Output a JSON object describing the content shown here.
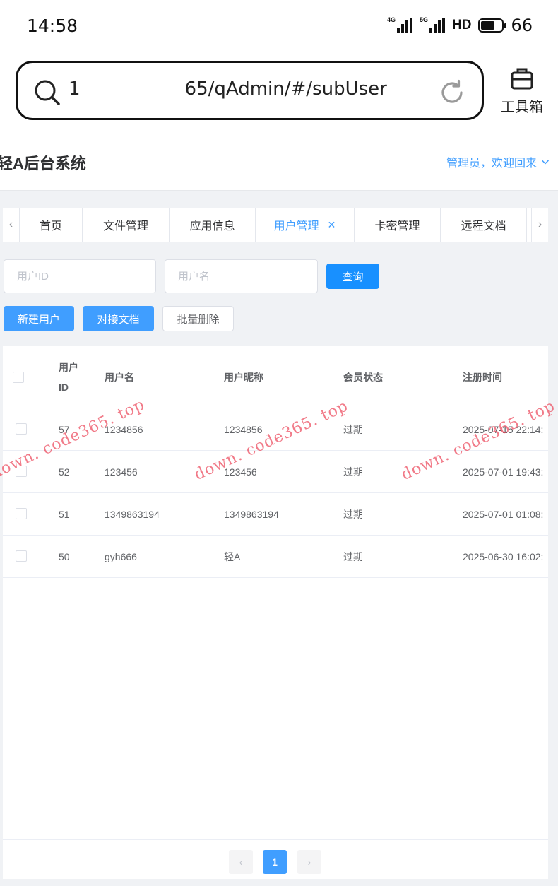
{
  "status_bar": {
    "time": "14:58",
    "signal1_tag": "4G",
    "signal2_tag": "5G",
    "hd": "HD",
    "battery": "66"
  },
  "browser": {
    "url_prefix": "1",
    "url_suffix": "65/qAdmin/#/subUser",
    "toolbox_label": "工具箱"
  },
  "app": {
    "title": "轻A后台系统",
    "user_menu": "管理员，欢迎回来"
  },
  "tabs": [
    {
      "label": "首页"
    },
    {
      "label": "文件管理"
    },
    {
      "label": "应用信息"
    },
    {
      "label": "用户管理"
    },
    {
      "label": "卡密管理"
    },
    {
      "label": "远程文档"
    }
  ],
  "search": {
    "user_id_placeholder": "用户ID",
    "username_placeholder": "用户名",
    "query_button": "查询"
  },
  "actions": {
    "new_user": "新建用户",
    "api_docs": "对接文档",
    "batch_delete": "批量删除"
  },
  "table": {
    "headers": {
      "id": "用户ID",
      "username": "用户名",
      "nickname": "用户昵称",
      "status": "会员状态",
      "reg_time": "注册时间"
    },
    "rows": [
      {
        "id": "57",
        "username": "1234856",
        "nickname": "1234856",
        "status": "过期",
        "reg_time": "2025-07-15 22:14:"
      },
      {
        "id": "52",
        "username": "123456",
        "nickname": "123456",
        "status": "过期",
        "reg_time": "2025-07-01 19:43:"
      },
      {
        "id": "51",
        "username": "1349863194",
        "nickname": "1349863194",
        "status": "过期",
        "reg_time": "2025-07-01 01:08:"
      },
      {
        "id": "50",
        "username": "gyh666",
        "nickname": "轻A",
        "status": "过期",
        "reg_time": "2025-06-30 16:02:"
      }
    ]
  },
  "pagination": {
    "current_page": "1",
    "prev": "‹",
    "next": "›"
  },
  "watermark": "down. code365. top",
  "colors": {
    "accent": "#409eff",
    "primary_button": "#1890ff",
    "watermark": "#eb465a"
  }
}
